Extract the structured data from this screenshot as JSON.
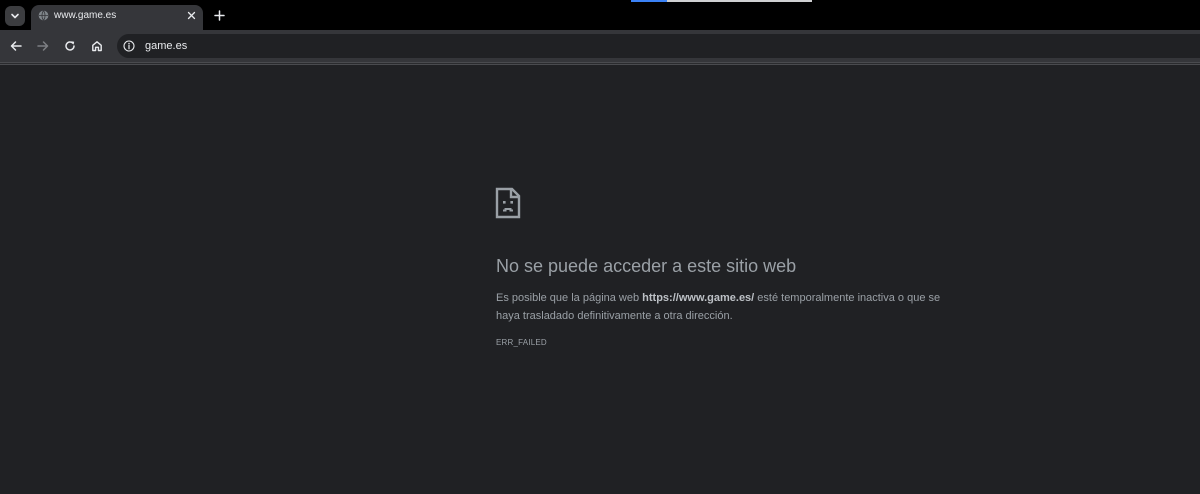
{
  "browser": {
    "tab": {
      "title": "www.game.es",
      "favicon": "globe-icon"
    },
    "address_bar": {
      "url": "game.es",
      "security_icon": "info-icon"
    },
    "nav_icons": [
      "back-arrow-icon",
      "forward-arrow-icon",
      "reload-icon",
      "home-icon"
    ]
  },
  "error_page": {
    "icon": "sad-page-icon",
    "title": "No se puede acceder a este sitio web",
    "description_before": "Es posible que la página web ",
    "description_url": "https://www.game.es/",
    "description_after": " esté temporalmente inactiva o que se haya trasladado definitivamente a otra dirección.",
    "error_code": "ERR_FAILED"
  },
  "colors": {
    "page_background": "#202124",
    "tabstrip_background": "#000000",
    "toolbar_background": "#35363a",
    "text_muted": "#9aa0a6",
    "accent_blue": "#3b82f6"
  }
}
